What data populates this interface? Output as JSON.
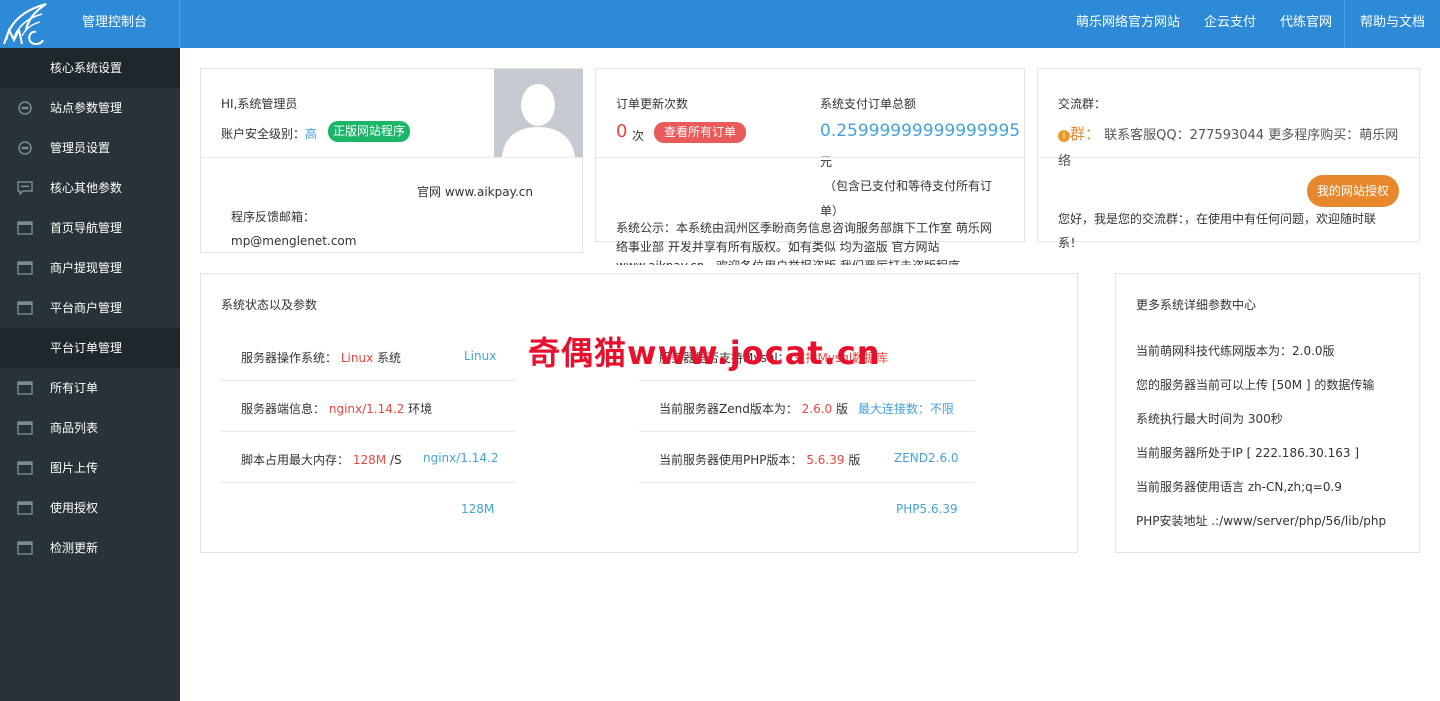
{
  "header": {
    "title": "管理控制台",
    "nav": [
      "萌乐网络官方网站",
      "企云支付",
      "代练官网",
      "帮助与文档"
    ]
  },
  "sidebar": {
    "items": [
      {
        "label": "核心系统设置",
        "section": true
      },
      {
        "label": "站点参数管理",
        "icon": "gear-icon"
      },
      {
        "label": "管理员设置",
        "icon": "gear-icon"
      },
      {
        "label": "核心其他参数",
        "icon": "chat-icon"
      },
      {
        "label": "首页导航管理",
        "icon": "window-icon"
      },
      {
        "label": "商户提现管理",
        "icon": "window-icon"
      },
      {
        "label": "平台商户管理",
        "icon": "window-icon"
      },
      {
        "label": "平台订单管理",
        "section": true
      },
      {
        "label": "所有订单",
        "icon": "window-icon"
      },
      {
        "label": "商品列表",
        "icon": "window-icon"
      },
      {
        "label": "图片上传",
        "icon": "window-icon"
      },
      {
        "label": "使用授权",
        "icon": "window-icon"
      },
      {
        "label": "检测更新",
        "icon": "window-icon"
      }
    ]
  },
  "admin": {
    "greeting": "HI,系统管理员",
    "security_label": "账户安全级别：",
    "security_level": "高",
    "genuine_btn": "正版网站程序",
    "site": "官网 www.aikpay.cn",
    "email_label": "程序反馈邮箱：",
    "email": "mp@menglenet.com"
  },
  "orders": {
    "update_label": "订单更新次数",
    "update_count": "0",
    "update_unit": "次",
    "view_btn": "查看所有订单",
    "total_label": "系统支付订单总额",
    "total_value": "0.25999999999999995",
    "total_unit": "元",
    "total_note_1": "（包含已支付和等待支付所有订",
    "total_note_2": "单）",
    "notice": "系统公示：本系统由润州区季盼商务信息咨询服务部旗下工作室 萌乐网络事业部 开发并享有所有版权。如有类似 均为盗版 官方网站 www.aikpay.cn，欢迎各位用户举报盗版 我们严厉打击盗版程序"
  },
  "group": {
    "title": "交流群：",
    "qun_label": "群：",
    "qun_text": "联系客服QQ：277593044 更多程序购买：萌乐网络",
    "auth_btn": "我的网站授权",
    "welcome": "您好，我是您的交流群：，在使用中有任何问题，欢迎随时联系！"
  },
  "status": {
    "title": "系统状态以及参数",
    "os_label": "服务器操作系统：",
    "os_value": "Linux",
    "os_suffix": "系统",
    "os_side": "Linux",
    "server_label": "服务器端信息：",
    "server_value": "nginx/1.14.2",
    "server_suffix": "环境",
    "mem_label": "脚本占用最大内存：",
    "mem_value": "128M",
    "mem_suffix": "/S",
    "mem_side": "nginx/1.14.2",
    "mem_bottom": "128M",
    "mysql_label": "服务器是否支持Mysql：",
    "mysql_value": "支持Mysql数据库",
    "zend_label": "当前服务器Zend版本为：",
    "zend_value": "2.6.0",
    "zend_suffix": "版",
    "conn_label": "最大连接数：不限",
    "php_label": "当前服务器使用PHP版本：",
    "php_value": "5.6.39",
    "php_suffix": "版",
    "zend_side": "ZEND2.6.0",
    "php_bottom": "PHP5.6.39"
  },
  "more": {
    "title": "更多系统详细参数中心",
    "lines": [
      "当前萌网科技代练网版本为：2.0.0版",
      "您的服务器当前可以上传 [50M ] 的数据传输",
      "系统执行最大时间为 300秒",
      "当前服务器所处于IP [ 222.186.30.163 ]",
      "当前服务器使用语言 zh-CN,zh;q=0.9",
      "PHP安装地址 .:/www/server/php/56/lib/php"
    ]
  },
  "watermark": "奇偶猫www.jocat.cn",
  "colors": {
    "header": "#2d8ad6",
    "sidebar": "#283339",
    "sidebar_section": "#1e272c",
    "green": "#1bb56a",
    "red": "#e95a5a",
    "orange": "#e8882c",
    "blue_text": "#45a2d8"
  }
}
